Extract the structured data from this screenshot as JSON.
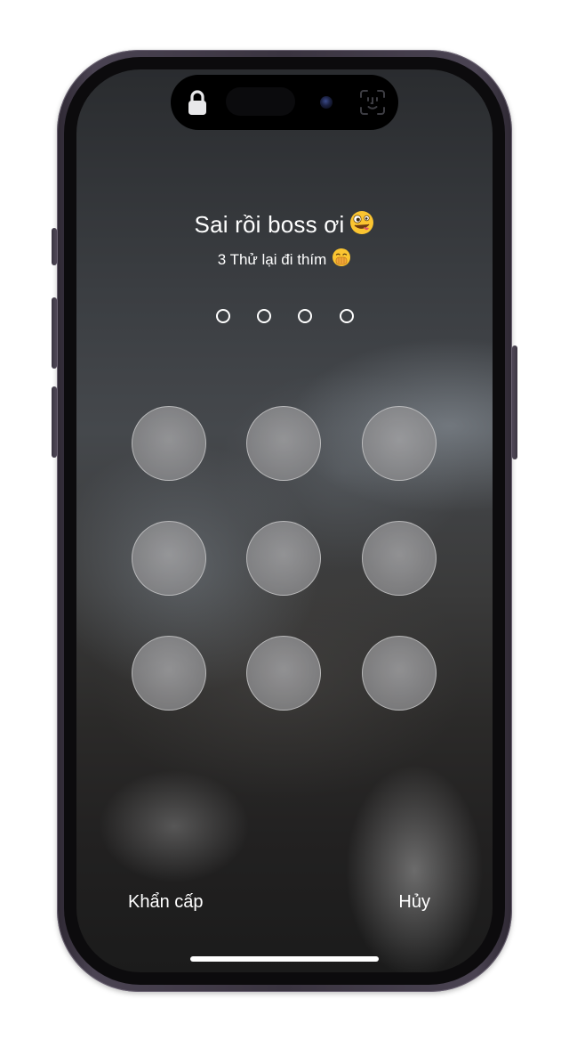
{
  "screen": {
    "title": "Sai rồi boss ơi",
    "title_emoji": "zany-face-emoji",
    "subtitle": "3 Thử lại đi thím",
    "subtitle_emoji": "face-with-hand-over-mouth-emoji",
    "passcode": {
      "length": 4,
      "entered": 0
    },
    "keypad": {
      "keys": [
        "",
        "",
        "",
        "",
        "",
        "",
        "",
        "",
        ""
      ]
    },
    "actions": {
      "emergency_label": "Khẩn cấp",
      "cancel_label": "Hủy"
    }
  },
  "dynamic_island": {
    "lock_icon": "lock-icon",
    "camera": "front-camera",
    "face_id_icon": "face-id-icon"
  },
  "colors": {
    "text": "#ffffff",
    "frame": "#3a3440",
    "key_fill": "#a0a0a2"
  }
}
